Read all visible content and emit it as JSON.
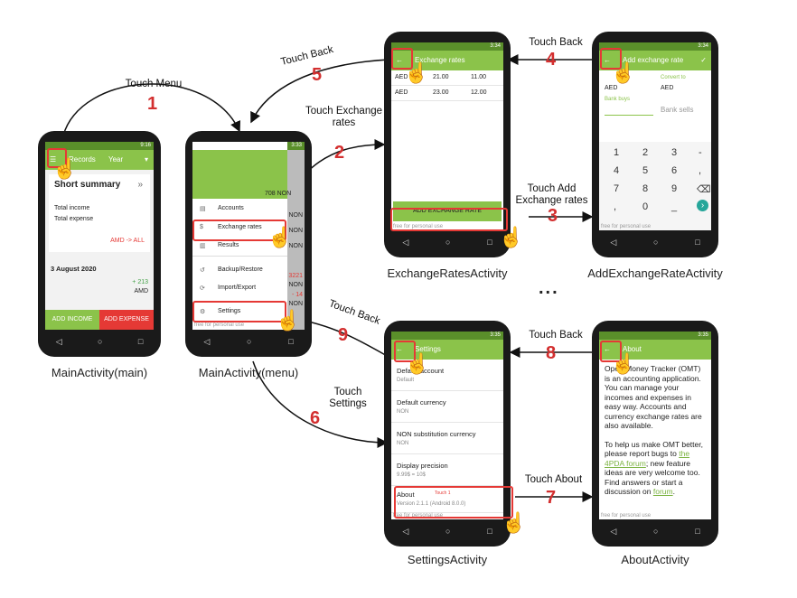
{
  "screens": {
    "main": {
      "caption": "MainActivity(main)",
      "status_time": "9:16",
      "app_title": "Records",
      "period": "Year",
      "summary_title": "Short summary",
      "total_income": "Total income",
      "total_expense": "Total expense",
      "currency_link": "AMD -> ALL",
      "date": "3 August 2020",
      "amount": "+ 213",
      "amount_cur": "AMD",
      "add_income": "ADD INCOME",
      "add_expense": "ADD EXPENSE"
    },
    "menu": {
      "caption": "MainActivity(menu)",
      "status_time": "3:33",
      "balance": "708 NON",
      "items": [
        "Accounts",
        "Exchange rates",
        "Results",
        "Backup/Restore",
        "Import/Export",
        "Settings"
      ],
      "side_values": [
        "NON",
        "NON",
        "NON",
        "3221",
        "NON",
        "- 14",
        "NON"
      ],
      "footer": "free for personal use"
    },
    "exchange": {
      "caption": "ExchangeRatesActivity",
      "status_time": "3:34",
      "title": "Exchange rates",
      "rows": [
        {
          "code": "AED",
          "a": "21.00",
          "b": "11.00"
        },
        {
          "code": "AED",
          "a": "23.00",
          "b": "12.00"
        }
      ],
      "button": "ADD EXCHANGE RATE",
      "footer": "free for personal use"
    },
    "add_rate": {
      "caption": "AddExchangeRateActivity",
      "status_time": "3:34",
      "title": "Add exchange rate",
      "convert_label": "Convert to",
      "from_value": "AED",
      "to_value": "AED",
      "bank_buys": "Bank buys",
      "bank_sells": "Bank sells",
      "keys": [
        "1",
        "2",
        "3",
        "-",
        "4",
        "5",
        "6",
        ",",
        "7",
        "8",
        "9",
        "⌫",
        ",",
        "0",
        "_",
        "›"
      ],
      "footer": "free for personal use"
    },
    "settings": {
      "caption": "SettingsActivity",
      "status_time": "3:35",
      "title": "Settings",
      "items": [
        {
          "label": "Default account",
          "value": "Default"
        },
        {
          "label": "Default currency",
          "value": "NON"
        },
        {
          "label": "NON substitution currency",
          "value": "NON"
        },
        {
          "label": "Display precision",
          "value": "9.99$ = 10$"
        },
        {
          "label": "About",
          "value": "Version 2.1.1 (Android 8.0.0)"
        }
      ],
      "touch_hint": "Touch 1",
      "footer": "free for personal use"
    },
    "about": {
      "caption": "AboutActivity",
      "status_time": "3:35",
      "title": "About",
      "para1": "Open Money Tracker (OMT) is an accounting application. You can manage your incomes and expenses in easy way. Accounts and currency exchange rates are also available.",
      "para2_a": "To help us make OMT better, please report bugs to ",
      "para2_link": "the 4PDA forum",
      "para2_b": "; new feature ideas are very welcome too. Find answers or start a discussion on ",
      "para2_link2": "forum",
      "para2_c": ".",
      "footer": "free for personal use"
    }
  },
  "steps": [
    {
      "num": "1",
      "label": "Touch Menu"
    },
    {
      "num": "2",
      "label": "Touch Exchange rates"
    },
    {
      "num": "3",
      "label": "Touch Add Exchange rates"
    },
    {
      "num": "4",
      "label": "Touch Back"
    },
    {
      "num": "5",
      "label": "Touch Back"
    },
    {
      "num": "6",
      "label": "Touch Settings"
    },
    {
      "num": "7",
      "label": "Touch About"
    },
    {
      "num": "8",
      "label": "Touch Back"
    },
    {
      "num": "9",
      "label": "Touch Back"
    }
  ],
  "ellipsis": "...",
  "nav_icons": [
    "back-icon",
    "home-icon",
    "recents-icon"
  ],
  "colors": {
    "accent": "#8bc34a",
    "status": "#5a8f2a",
    "expense": "#e53935",
    "step": "#d32f2f"
  }
}
